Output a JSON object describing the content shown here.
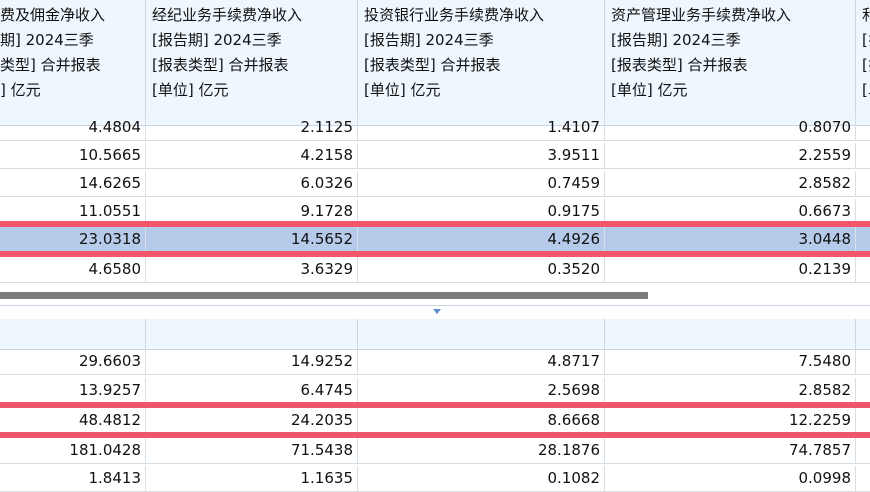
{
  "columns": [
    {
      "title": "费及佣金净收入",
      "period": "期] 2024三季",
      "type": "类型] 合并报表",
      "unit": "] 亿元"
    },
    {
      "title": "经纪业务手续费净收入",
      "period": "[报告期] 2024三季",
      "type": "[报表类型] 合并报表",
      "unit": "[单位] 亿元"
    },
    {
      "title": "投资银行业务手续费净收入",
      "period": "[报告期] 2024三季",
      "type": "[报表类型] 合并报表",
      "unit": "[单位] 亿元"
    },
    {
      "title": "资产管理业务手续费净收入",
      "period": "[报告期] 2024三季",
      "type": "[报表类型] 合并报表",
      "unit": "[单位] 亿元"
    },
    {
      "title": "和",
      "period": "[扌",
      "type": "[扌",
      "unit": "[单"
    }
  ],
  "top_rows": [
    [
      "4.4804",
      "2.1125",
      "1.4107",
      "0.8070"
    ],
    [
      "10.5665",
      "4.2158",
      "3.9511",
      "2.2559"
    ],
    [
      "14.6265",
      "6.0326",
      "0.7459",
      "2.8582"
    ],
    [
      "11.0551",
      "9.1728",
      "0.9175",
      "0.6673"
    ],
    [
      "23.0318",
      "14.5652",
      "4.4926",
      "3.0448"
    ],
    [
      "4.6580",
      "3.6329",
      "0.3520",
      "0.2139"
    ]
  ],
  "bottom_rows": [
    [
      "29.6603",
      "14.9252",
      "4.8717",
      "7.5480"
    ],
    [
      "13.9257",
      "6.4745",
      "2.5698",
      "2.8582"
    ],
    [
      "48.4812",
      "24.2035",
      "8.6668",
      "12.2259"
    ],
    [
      "181.0428",
      "71.5438",
      "28.1876",
      "74.7857"
    ],
    [
      "1.8413",
      "1.1635",
      "0.1082",
      "0.0998"
    ]
  ],
  "colors": {
    "highlight_band": "#f2566b",
    "selected_row": "#b5cbe9",
    "header_bg": "#eef7fe"
  }
}
